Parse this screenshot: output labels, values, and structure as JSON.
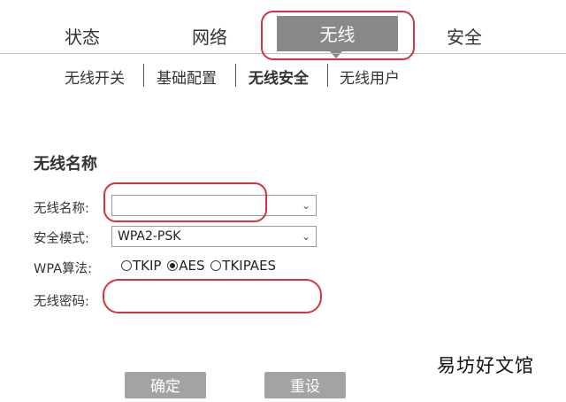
{
  "top_nav": {
    "tabs": [
      {
        "label": "状态"
      },
      {
        "label": "网络"
      },
      {
        "label": "无线"
      },
      {
        "label": "安全"
      }
    ],
    "active": "无线"
  },
  "sub_nav": {
    "items": [
      {
        "label": "无线开关"
      },
      {
        "label": "基础配置"
      },
      {
        "label": "无线安全"
      },
      {
        "label": "无线用户"
      }
    ],
    "active": "无线安全"
  },
  "section": {
    "title": "无线名称"
  },
  "form": {
    "ssid_label": "无线名称:",
    "ssid_value": "",
    "security_mode_label": "安全模式:",
    "security_mode_value": "WPA2-PSK",
    "wpa_label": "WPA算法:",
    "wpa_options": [
      "TKIP",
      "AES",
      "TKIPAES"
    ],
    "wpa_selected": "AES",
    "password_label": "无线密码:",
    "password_value": ""
  },
  "buttons": {
    "confirm": "确定",
    "reset": "重设"
  },
  "watermark": "易坊好文馆",
  "colors": {
    "tab_active_bg": "#888888",
    "annotation": "#d4353d",
    "button_bg": "#a3a3a3"
  }
}
